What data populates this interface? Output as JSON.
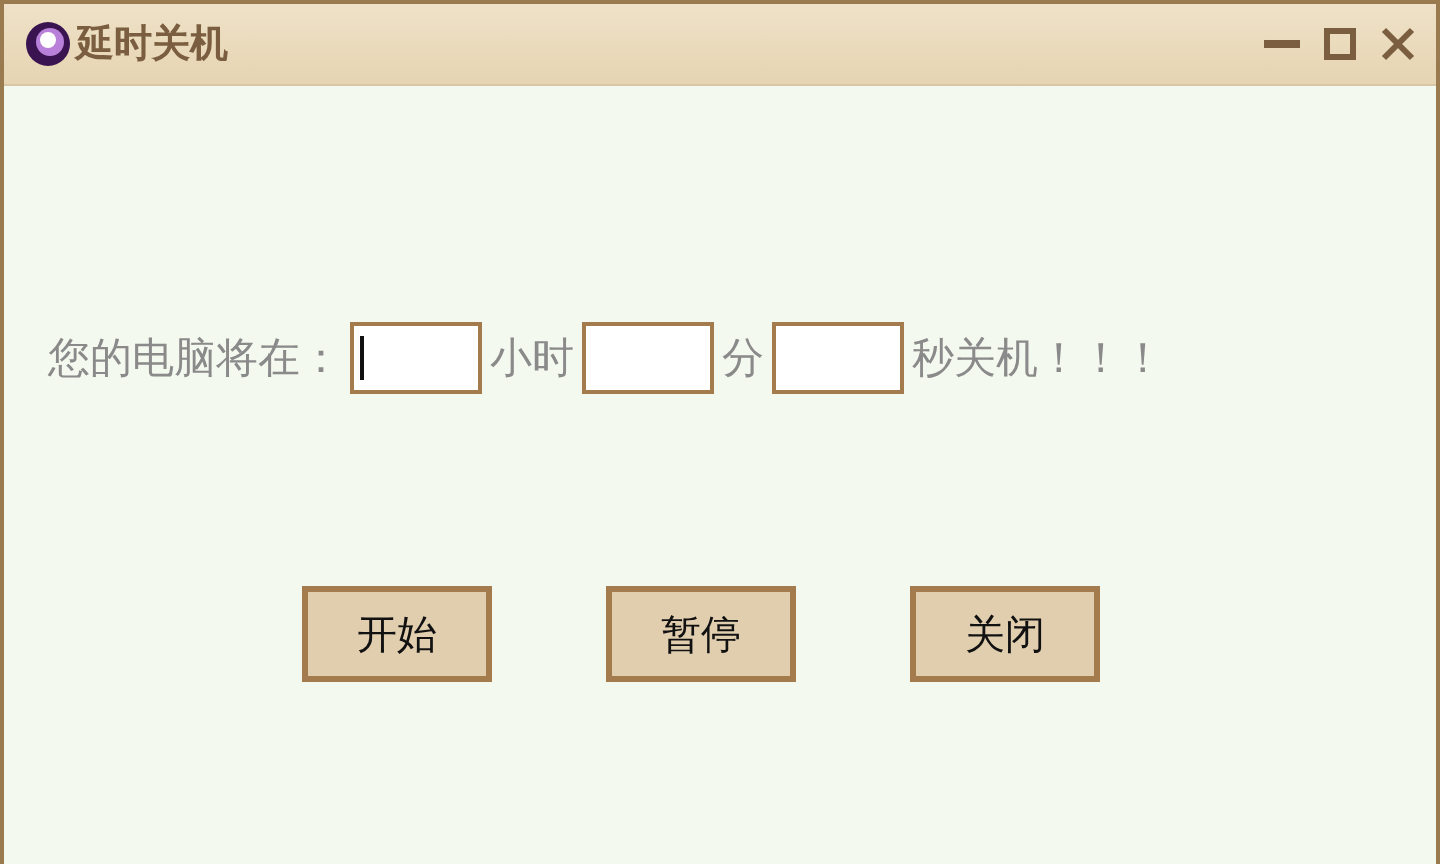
{
  "window": {
    "title": "延时关机"
  },
  "form": {
    "parts": [
      {
        "kind": "text",
        "text": "您的电脑将在："
      },
      {
        "kind": "field",
        "focused": true
      },
      {
        "kind": "text",
        "text": "小时"
      },
      {
        "kind": "field",
        "focused": false
      },
      {
        "kind": "text",
        "text": "分"
      },
      {
        "kind": "field",
        "focused": false
      },
      {
        "kind": "text",
        "text": "秒关机！！！"
      }
    ]
  },
  "buttons": [
    "开始",
    "暂停",
    "关闭"
  ]
}
